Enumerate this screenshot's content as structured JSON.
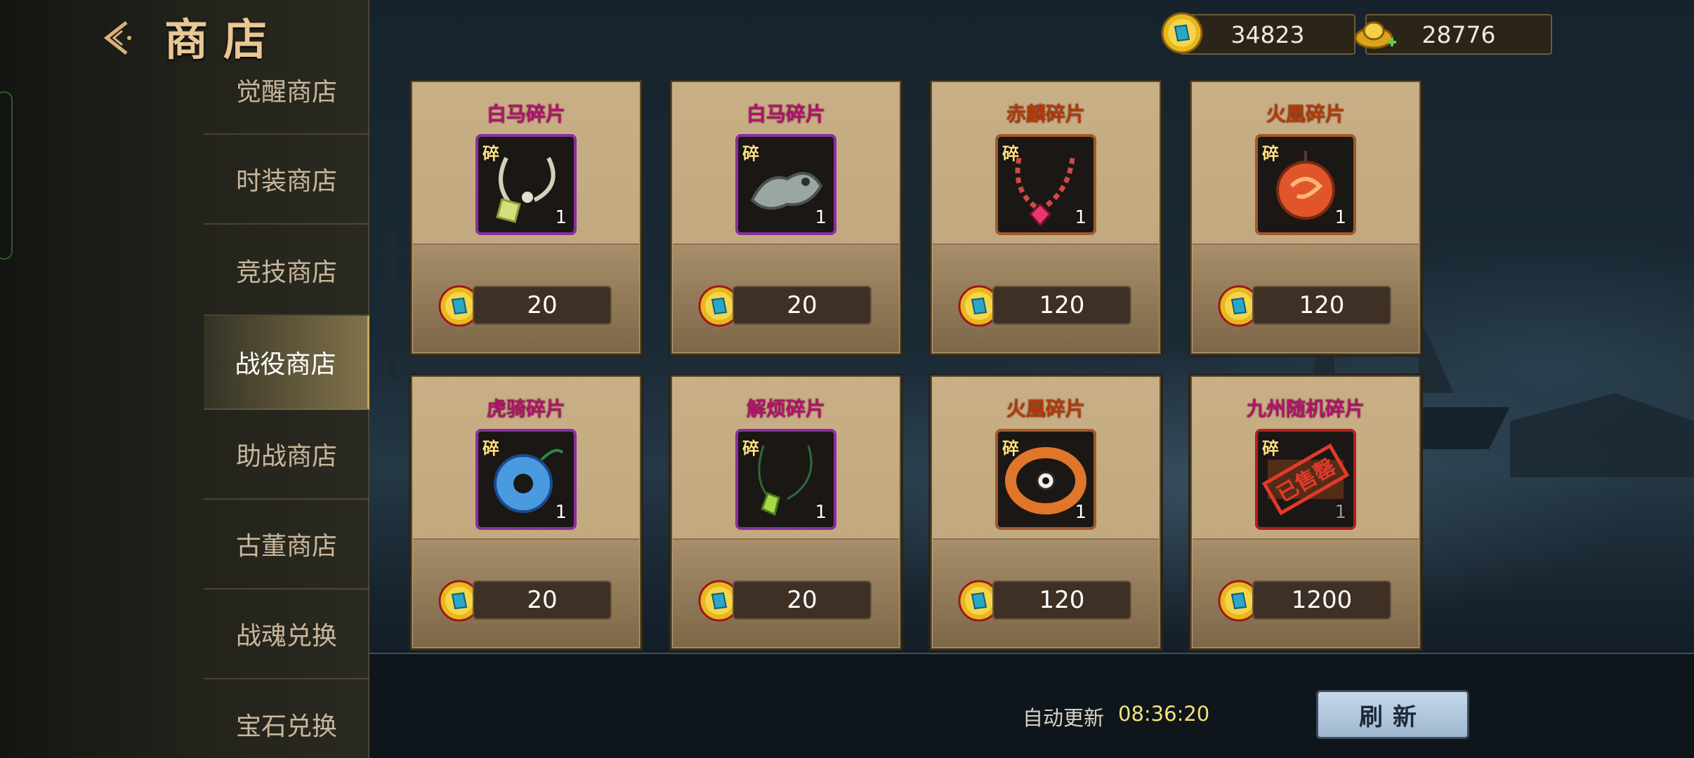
{
  "header": {
    "title": "商店",
    "back_icon": "back-arrow-icon"
  },
  "sidebar": {
    "items": [
      {
        "label": "觉醒商店"
      },
      {
        "label": "时装商店"
      },
      {
        "label": "竞技商店"
      },
      {
        "label": "战役商店",
        "active": true
      },
      {
        "label": "助战商店"
      },
      {
        "label": "古董商店"
      },
      {
        "label": "战魂兑换"
      },
      {
        "label": "宝石兑换"
      }
    ]
  },
  "currency": {
    "coins": "34823",
    "ingots": "28776"
  },
  "items": [
    {
      "name": "白马碎片",
      "name_color": "#b4106e",
      "badge": "碎",
      "qty": "1",
      "price": "20",
      "frame": "#8a2fa0",
      "art": "necklace-green-icon"
    },
    {
      "name": "白马碎片",
      "name_color": "#b4106e",
      "badge": "碎",
      "qty": "1",
      "price": "20",
      "frame": "#8a2fa0",
      "art": "jade-beast-icon"
    },
    {
      "name": "赤麟碎片",
      "name_color": "#b43a0a",
      "badge": "碎",
      "qty": "1",
      "price": "120",
      "frame": "#a05a2a",
      "art": "necklace-red-icon"
    },
    {
      "name": "火凰碎片",
      "name_color": "#b43a0a",
      "badge": "碎",
      "qty": "1",
      "price": "120",
      "frame": "#a05a2a",
      "art": "phoenix-pendant-icon"
    },
    {
      "name": "虎骑碎片",
      "name_color": "#b4106e",
      "badge": "碎",
      "qty": "1",
      "price": "20",
      "frame": "#8a2fa0",
      "art": "blue-jade-icon"
    },
    {
      "name": "解烦碎片",
      "name_color": "#b4106e",
      "badge": "碎",
      "qty": "1",
      "price": "20",
      "frame": "#8a2fa0",
      "art": "green-pendant-icon"
    },
    {
      "name": "火凰碎片",
      "name_color": "#b43a0a",
      "badge": "碎",
      "qty": "1",
      "price": "120",
      "frame": "#a05a2a",
      "art": "orange-ring-icon"
    },
    {
      "name": "九州随机碎片",
      "name_color": "#b4106e",
      "badge": "碎",
      "qty": "1",
      "price": "1200",
      "frame": "#b02020",
      "art": "sold-out-stamp-icon",
      "stamp_text": "已售罄",
      "sold_out": true
    }
  ],
  "footer": {
    "auto_update_label": "自动更新",
    "auto_update_time": "08:36:20",
    "refresh_label": "刷新"
  },
  "colors": {
    "gold_text": "#e9c895",
    "time_text": "#f6e27a",
    "refresh_button": "#b6cbe0"
  }
}
